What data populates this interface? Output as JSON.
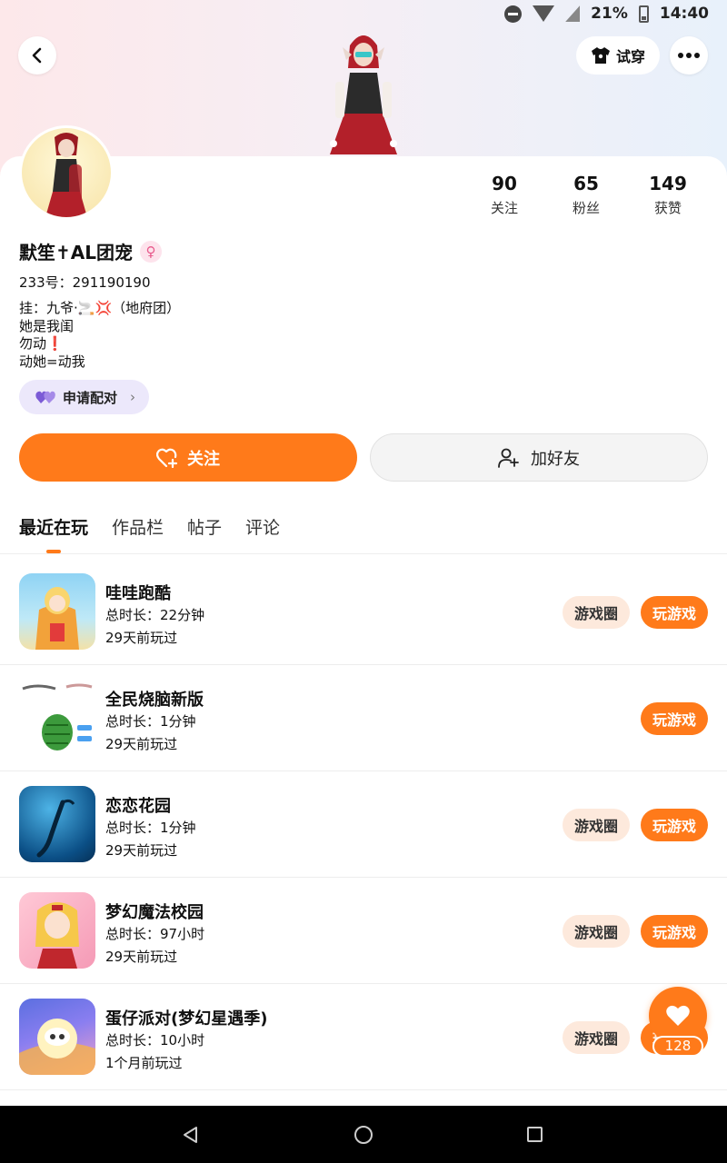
{
  "status_bar": {
    "battery": "21%",
    "time": "14:40"
  },
  "header": {
    "try_on_label": "试穿"
  },
  "profile": {
    "nickname": "默笙✝AL团宠",
    "gender_symbol": "♀",
    "uid": "233号：291190190",
    "bio": [
      "挂：九爷·🚬💢（地府团）",
      "她是我闺",
      "勿动❗",
      "动她=动我"
    ],
    "stats": [
      {
        "value": "90",
        "label": "关注"
      },
      {
        "value": "65",
        "label": "粉丝"
      },
      {
        "value": "149",
        "label": "获赞"
      }
    ],
    "pair_label": "申请配对",
    "follow_label": "关注",
    "add_friend_label": "加好友"
  },
  "tabs": [
    {
      "label": "最近在玩",
      "active": true
    },
    {
      "label": "作品栏",
      "active": false
    },
    {
      "label": "帖子",
      "active": false
    },
    {
      "label": "评论",
      "active": false
    }
  ],
  "games": [
    {
      "title": "哇哇跑酷",
      "duration": "总时长：22分钟",
      "last_played": "29天前玩过",
      "circle_label": "游戏圈",
      "play_label": "玩游戏"
    },
    {
      "title": "全民烧脑新版",
      "duration": "总时长：1分钟",
      "last_played": "29天前玩过",
      "circle_label": "",
      "play_label": "玩游戏"
    },
    {
      "title": "恋恋花园",
      "duration": "总时长：1分钟",
      "last_played": "29天前玩过",
      "circle_label": "游戏圈",
      "play_label": "玩游戏"
    },
    {
      "title": "梦幻魔法校园",
      "duration": "总时长：97小时",
      "last_played": "29天前玩过",
      "circle_label": "游戏圈",
      "play_label": "玩游戏"
    },
    {
      "title": "蛋仔派对(梦幻星遇季)",
      "duration": "总时长：10小时",
      "last_played": "1个月前玩过",
      "circle_label": "游戏圈",
      "play_label": "玩游戏"
    }
  ],
  "fab": {
    "count": "128"
  },
  "colors": {
    "accent": "#ff7a1a",
    "circle_bg": "#fde9dc",
    "pair_bg": "#ece8fb"
  }
}
